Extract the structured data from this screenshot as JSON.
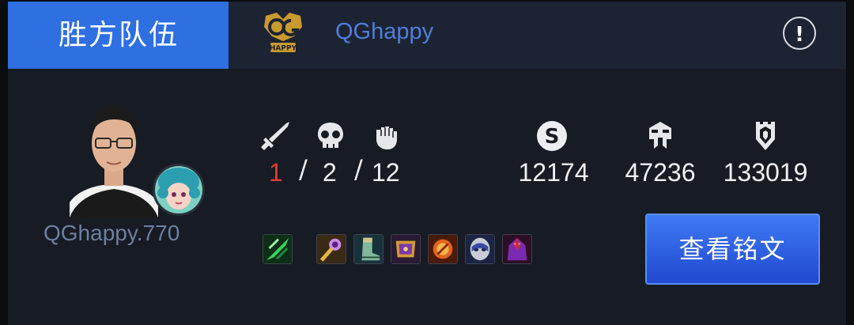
{
  "header": {
    "result_label": "胜方队伍",
    "team_name": "QGhappy",
    "info_icon_glyph": "!"
  },
  "player": {
    "name": "QGhappy.770"
  },
  "kda": {
    "kills": "1",
    "separator1": "/",
    "deaths": "2",
    "separator2": "/",
    "assists": "12"
  },
  "economy": {
    "gold": "12174",
    "damage_dealt": "47236",
    "damage_taken": "133019"
  },
  "icons": {
    "kills": "sword-icon",
    "deaths": "skull-icon",
    "assists": "fist-icon",
    "gold": "coin-icon",
    "damage_dealt": "helmet-icon",
    "damage_taken": "shield-icon"
  },
  "items": [
    "summoner-spell-icon",
    "item-scepter-icon",
    "item-boots-icon",
    "item-book-icon",
    "item-fire-orb-icon",
    "item-mask-icon",
    "item-cloak-icon"
  ],
  "actions": {
    "view_runes": "查看铭文"
  },
  "colors": {
    "accent_blue": "#2e6fe2",
    "kills_red": "#e03a36",
    "team_name_blue": "#4f7ed9",
    "background": "#171b23"
  }
}
